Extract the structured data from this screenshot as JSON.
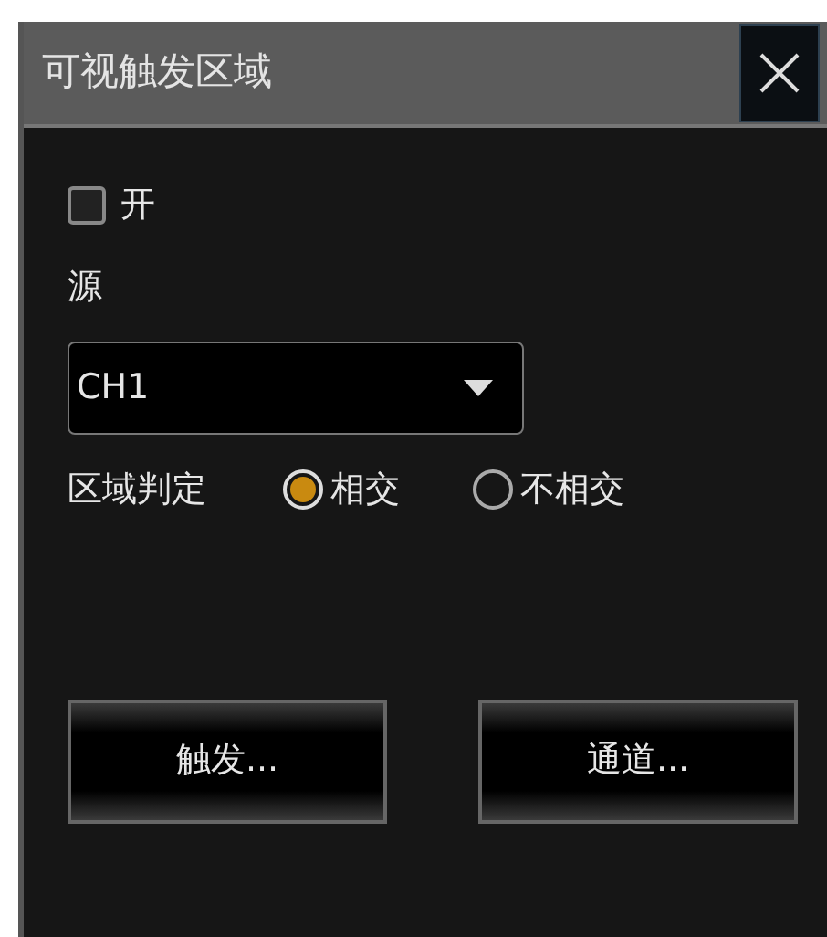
{
  "window": {
    "title": "可视触发区域"
  },
  "enable": {
    "label": "开",
    "checked": false
  },
  "source": {
    "label": "源",
    "value": "CH1"
  },
  "region_judgement": {
    "label": "区域判定",
    "options": [
      {
        "label": "相交",
        "selected": true
      },
      {
        "label": "不相交",
        "selected": false
      }
    ]
  },
  "buttons": [
    "触发...",
    "通道..."
  ]
}
